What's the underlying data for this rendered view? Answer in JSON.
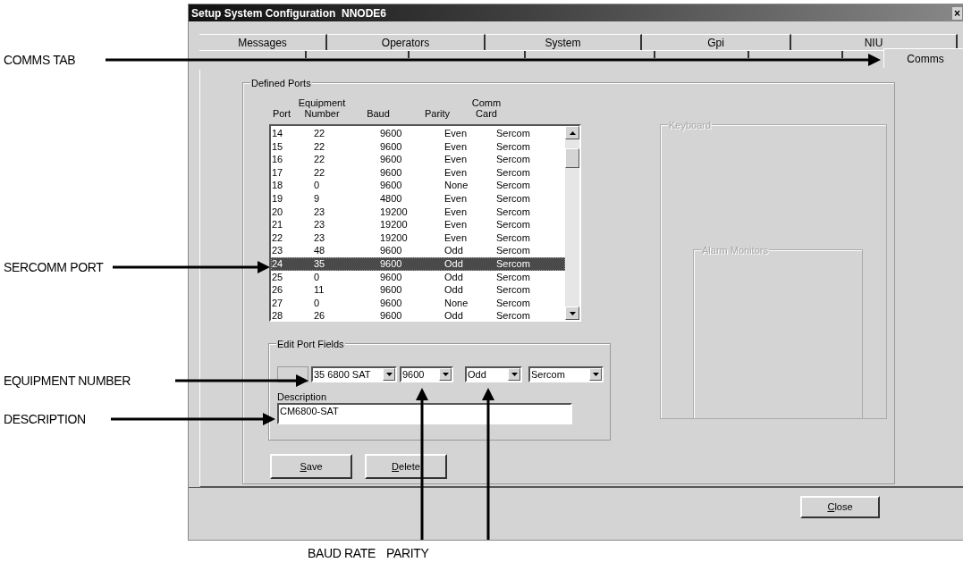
{
  "window": {
    "title": "Setup System Configuration  NNODE6",
    "close_glyph": "×"
  },
  "tabs_back_row": [
    {
      "label": "Messages",
      "selected": false
    },
    {
      "label": "Operators",
      "selected": false
    },
    {
      "label": "System",
      "selected": false
    },
    {
      "label": "Gpi",
      "selected": false
    },
    {
      "label": "NIU",
      "selected": false
    }
  ],
  "tabs_front_row": [
    {
      "label": "Comms",
      "selected": true
    }
  ],
  "defined_ports": {
    "title": "Defined Ports",
    "columns": [
      "Port",
      "Equipment Number",
      "Baud",
      "Parity",
      "Comm Card"
    ],
    "rows": [
      {
        "cells": [
          "14",
          "22",
          "9600",
          "Even",
          "Sercom"
        ],
        "selected": false
      },
      {
        "cells": [
          "15",
          "22",
          "9600",
          "Even",
          "Sercom"
        ],
        "selected": false
      },
      {
        "cells": [
          "16",
          "22",
          "9600",
          "Even",
          "Sercom"
        ],
        "selected": false
      },
      {
        "cells": [
          "17",
          "22",
          "9600",
          "Even",
          "Sercom"
        ],
        "selected": false
      },
      {
        "cells": [
          "18",
          "0",
          "9600",
          "None",
          "Sercom"
        ],
        "selected": false
      },
      {
        "cells": [
          "19",
          "9",
          "4800",
          "Even",
          "Sercom"
        ],
        "selected": false
      },
      {
        "cells": [
          "20",
          "23",
          "19200",
          "Even",
          "Sercom"
        ],
        "selected": false
      },
      {
        "cells": [
          "21",
          "23",
          "19200",
          "Even",
          "Sercom"
        ],
        "selected": false
      },
      {
        "cells": [
          "22",
          "23",
          "19200",
          "Even",
          "Sercom"
        ],
        "selected": false
      },
      {
        "cells": [
          "23",
          "48",
          "9600",
          "Odd",
          "Sercom"
        ],
        "selected": false
      },
      {
        "cells": [
          "24",
          "35",
          "9600",
          "Odd",
          "Sercom"
        ],
        "selected": true
      },
      {
        "cells": [
          "25",
          "0",
          "9600",
          "Odd",
          "Sercom"
        ],
        "selected": false
      },
      {
        "cells": [
          "26",
          "11",
          "9600",
          "Odd",
          "Sercom"
        ],
        "selected": false
      },
      {
        "cells": [
          "27",
          "0",
          "9600",
          "None",
          "Sercom"
        ],
        "selected": false
      },
      {
        "cells": [
          "28",
          "26",
          "9600",
          "Odd",
          "Sercom"
        ],
        "selected": false
      }
    ]
  },
  "keyboard_group": {
    "title": "Keyboard",
    "disabled": true
  },
  "alarm_monitors_group": {
    "title": "Alarm Monitors",
    "disabled": true
  },
  "edit_port_fields": {
    "title": "Edit Port Fields",
    "port_field": {
      "disabled": true
    },
    "combos": [
      {
        "value": "35 6800 SAT"
      },
      {
        "value": "9600"
      },
      {
        "value": "Odd"
      },
      {
        "value": "Sercom"
      }
    ],
    "description": {
      "label": "Description",
      "value": "CM6800-SAT"
    }
  },
  "buttons": [
    {
      "label": "Save"
    },
    {
      "label": "Delete"
    }
  ],
  "close_button": {
    "label": "Close"
  },
  "callouts": [
    {
      "label": "COMMS TAB"
    },
    {
      "label": "SERCOMM PORT"
    },
    {
      "label": "EQUIPMENT NUMBER"
    },
    {
      "label": "DESCRIPTION"
    },
    {
      "label": "BAUD RATE"
    },
    {
      "label": "PARITY"
    }
  ]
}
